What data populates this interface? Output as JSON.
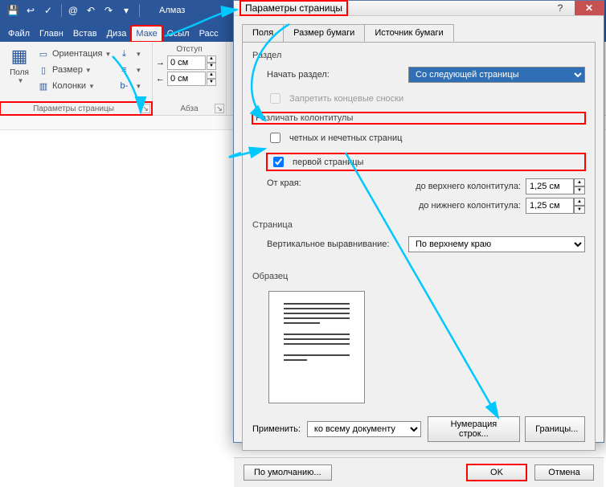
{
  "qat": {
    "icons": [
      "save-icon",
      "undo-icon",
      "spell-icon",
      "at-icon",
      "undo2-icon",
      "redo-icon",
      "more-icon"
    ],
    "username": "Алмаз"
  },
  "tabs": {
    "items": [
      "Файл",
      "Главн",
      "Встав",
      "Диза",
      "Маке",
      "Ссыл",
      "Расс"
    ],
    "active_index": 4
  },
  "ribbon": {
    "group_margins": {
      "fields_btn": "Поля",
      "orientation": "Ориентация",
      "size": "Размер",
      "columns": "Колонки",
      "title": "Параметры страницы"
    },
    "group_indent": {
      "indent_label": "Отступ",
      "left_value": "0 см",
      "right_value": "0 см"
    },
    "group_para": {
      "title": "Абза"
    }
  },
  "dialog": {
    "title": "Параметры страницы",
    "tabs": {
      "items": [
        "Поля",
        "Размер бумаги",
        "Источник бумаги"
      ],
      "active_index": 2
    },
    "section": {
      "label": "Раздел",
      "start_label": "Начать раздел:",
      "start_value": "Со следующей страницы",
      "endnotes_label": "Запретить концевые сноски"
    },
    "headers": {
      "label": "Различать колонтитулы",
      "odd_even": "четных и нечетных страниц",
      "first_page": "первой страницы",
      "from_edge": "От края:",
      "top_label": "до верхнего колонтитула:",
      "top_value": "1,25 см",
      "bottom_label": "до нижнего колонтитула:",
      "bottom_value": "1,25 см"
    },
    "page": {
      "label": "Страница",
      "valign_label": "Вертикальное выравнивание:",
      "valign_value": "По верхнему краю"
    },
    "sample": {
      "label": "Образец"
    },
    "apply": {
      "label": "Применить:",
      "value": "ко всему документу",
      "line_numbers": "Нумерация строк...",
      "borders": "Границы..."
    },
    "footer": {
      "default_btn": "По умолчанию...",
      "ok": "OK",
      "cancel": "Отмена"
    }
  }
}
